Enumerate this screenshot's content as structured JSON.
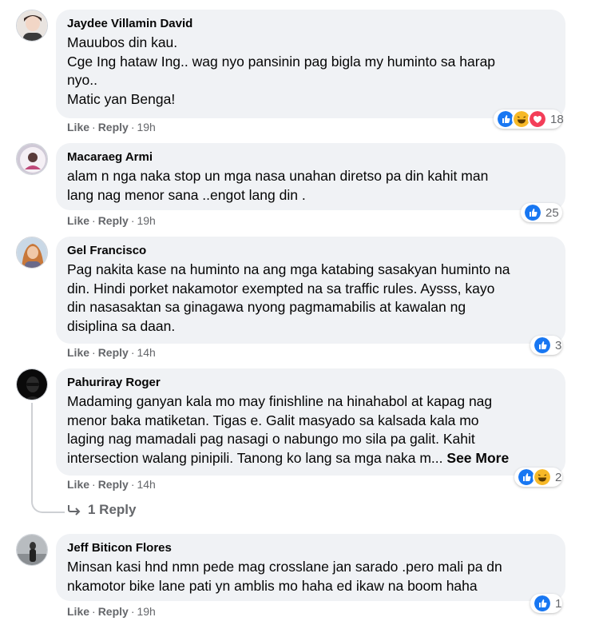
{
  "comments": [
    {
      "author": "Jaydee Villamin David",
      "lines": [
        "Mauubos din kau.",
        "Cge Ing hataw Ing.. wag nyo pansinin pag bigla my huminto sa harap",
        "nyo..",
        "Matic yan Benga!"
      ],
      "like": "Like",
      "sep1": "·",
      "reply": "Reply",
      "sep2": "·",
      "time": "19h",
      "reactions": [
        "like-reaction-icon",
        "haha-reaction-icon",
        "love-reaction-icon"
      ],
      "count": "18"
    },
    {
      "author": "Macaraeg Armi",
      "lines": [
        "alam n nga naka stop un mga nasa unahan diretso pa din kahit man",
        "lang nag menor sana ..engot lang din ."
      ],
      "like": "Like",
      "sep1": "·",
      "reply": "Reply",
      "sep2": "·",
      "time": "19h",
      "reactions": [
        "like-reaction-icon"
      ],
      "count": "25"
    },
    {
      "author": "Gel Francisco",
      "lines": [
        "Pag nakita kase na huminto na ang mga katabing sasakyan huminto na",
        "din. Hindi porket nakamotor exempted na sa traffic rules. Aysss, kayo",
        "din nasasaktan sa ginagawa nyong pagmamabilis at kawalan ng",
        "disiplina sa daan."
      ],
      "like": "Like",
      "sep1": "·",
      "reply": "Reply",
      "sep2": "·",
      "time": "14h",
      "reactions": [
        "like-reaction-icon"
      ],
      "count": "3"
    },
    {
      "author": "Pahuriray Roger",
      "lines": [
        "Madaming ganyan kala mo may finishline na hinahabol at kapag nag",
        "menor baka matiketan. Tigas e. Galit masyado sa kalsada kala mo",
        "laging nag mamadali pag nasagi o nabungo mo sila pa galit. Kahit",
        "intersection walang pinipili. Tanong ko lang sa mga naka m..."
      ],
      "see_more": "See More",
      "like": "Like",
      "sep1": "·",
      "reply": "Reply",
      "sep2": "·",
      "time": "14h",
      "reactions": [
        "like-reaction-icon",
        "haha-reaction-icon"
      ],
      "count": "2",
      "replies_link": "1 Reply"
    },
    {
      "author": "Jeff Biticon Flores",
      "lines": [
        "Minsan kasi hnd nmn pede mag crosslane jan sarado .pero mali pa dn",
        "nkamotor bike lane pati yn amblis mo haha ed ikaw na boom haha"
      ],
      "like": "Like",
      "sep1": "·",
      "reply": "Reply",
      "sep2": "·",
      "time": "19h",
      "reactions": [
        "like-reaction-icon"
      ],
      "count": "1"
    }
  ],
  "colors": {
    "bubble": "#f0f2f5",
    "secondary_text": "#65676b",
    "like_blue": "#1877f2",
    "haha_yellow": "#f7b928",
    "love_red": "#f33e58"
  }
}
